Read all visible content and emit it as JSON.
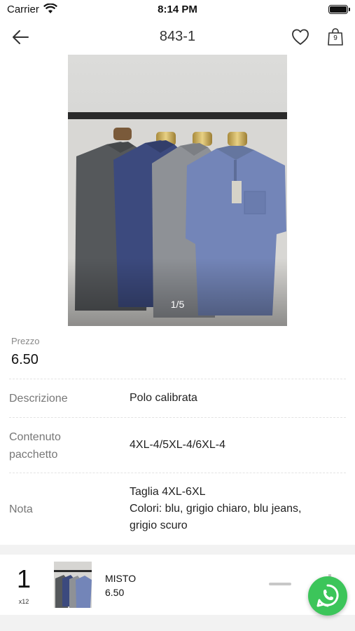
{
  "status_bar": {
    "carrier": "Carrier",
    "time": "8:14 PM"
  },
  "nav": {
    "title": "843-1",
    "cart_count": "9"
  },
  "gallery": {
    "counter": "1/5"
  },
  "price": {
    "label": "Prezzo",
    "value": "6.50"
  },
  "rows": [
    {
      "label": "Descrizione",
      "value": "Polo calibrata"
    },
    {
      "label_line1": "Contenuto",
      "label_line2": "pacchetto",
      "value": "4XL-4/5XL-4/6XL-4"
    },
    {
      "label": "Nota",
      "value_line1": "Taglia 4XL-6XL",
      "value_line2": "Colori: blu, grigio chiaro, blu jeans,",
      "value_line3": "grigio scuro"
    }
  ],
  "cart": {
    "quantity": "1",
    "multiplier": "x12",
    "name": "MISTO",
    "price": "6.50"
  },
  "icons": [
    "wifi-icon",
    "battery-icon",
    "back-arrow-icon",
    "heart-icon",
    "shopping-bag-icon",
    "minus-icon",
    "plus-icon",
    "whatsapp-icon"
  ],
  "colors": {
    "whatsapp": "#3cc55a",
    "background": "#f2f2f2"
  }
}
